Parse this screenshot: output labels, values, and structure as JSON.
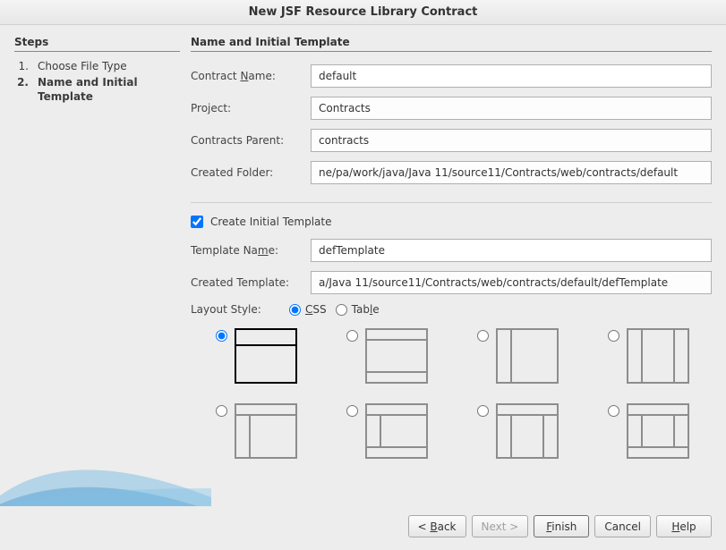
{
  "window": {
    "title": "New JSF Resource Library Contract"
  },
  "sidebar": {
    "heading": "Steps",
    "items": [
      {
        "num": "1.",
        "label": "Choose File Type",
        "current": false
      },
      {
        "num": "2.",
        "label": "Name and Initial Template",
        "current": true
      }
    ]
  },
  "panel": {
    "heading": "Name and Initial Template",
    "contract_name_label_pre": "Contract ",
    "contract_name_label_mn": "N",
    "contract_name_label_post": "ame:",
    "contract_name_value": "default",
    "project_label": "Project:",
    "project_value": "Contracts",
    "contracts_parent_label": "Contracts Parent:",
    "contracts_parent_value": "contracts",
    "created_folder_label": "Created Folder:",
    "created_folder_value": "ne/pa/work/java/Java 11/source11/Contracts/web/contracts/default",
    "create_template_label_pre": "Create ",
    "create_template_label_mn": "I",
    "create_template_label_post": "nitial Template",
    "create_template_checked": true,
    "template_name_label_pre": "Template Na",
    "template_name_label_mn": "m",
    "template_name_label_post": "e:",
    "template_name_value": "defTemplate",
    "created_template_label": "Created Template:",
    "created_template_value": "a/Java 11/source11/Contracts/web/contracts/default/defTemplate",
    "layout_style_label_pre": "La",
    "layout_style_label_mn": "y",
    "layout_style_label_post": "out Style:",
    "layout_css_mn": "C",
    "layout_css_post": "SS",
    "layout_table_pre": "Tab",
    "layout_table_mn": "l",
    "layout_table_post": "e",
    "layout_css_selected": true,
    "selected_layout_index": 0
  },
  "buttons": {
    "back_pre": "< ",
    "back_mn": "B",
    "back_post": "ack",
    "next": "Next >",
    "finish_mn": "F",
    "finish_post": "inish",
    "cancel": "Cancel",
    "help_mn": "H",
    "help_post": "elp"
  }
}
